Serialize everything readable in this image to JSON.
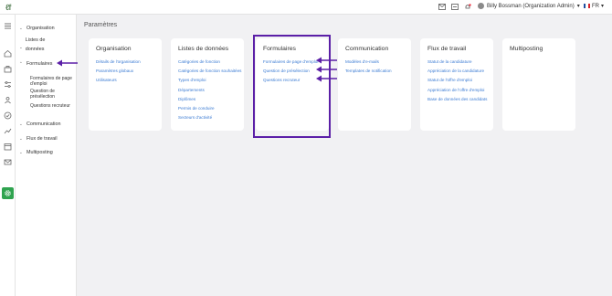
{
  "topbar": {
    "logo": "ℓf",
    "user_name": "Billy Bossman (Organization Admin)",
    "user_chevron": "▾",
    "language": "FR",
    "language_chevron": "▾"
  },
  "nav": {
    "items": [
      {
        "label": "Organisation",
        "chevron": "⌄"
      },
      {
        "label": "Listes de données",
        "chevron": "⌄"
      },
      {
        "label": "Formulaires",
        "chevron": "⌃"
      },
      {
        "label": "Communication",
        "chevron": "⌄"
      },
      {
        "label": "Flux de travail",
        "chevron": "⌄"
      },
      {
        "label": "Multiposting",
        "chevron": "⌄"
      }
    ],
    "formulaires_subitems": [
      "Formulaires de page d'emploi",
      "Question de présélection",
      "Questions recruteur"
    ]
  },
  "page_title": "Paramètres",
  "cards": [
    {
      "title": "Organisation",
      "links": [
        "Détails de l'organisation",
        "Paramètres globaux",
        "Utilisateurs"
      ]
    },
    {
      "title": "Listes de données",
      "links": [
        "Catégories de fonction",
        "Catégories de fonction souhaitées",
        "Types d'emploi",
        "Départements",
        "Diplômes",
        "Permis de conduire",
        "Secteurs d'activité"
      ]
    },
    {
      "title": "Formulaires",
      "links": [
        "Formulaires de page d'emploi",
        "Question de présélection",
        "Questions recruteur"
      ]
    },
    {
      "title": "Communication",
      "links": [
        "Modèles d'e-mails",
        "Templates de notification"
      ]
    },
    {
      "title": "Flux de travail",
      "links": [
        "Statut de la candidature",
        "Appréciation de la candidature",
        "Statut de l'offre d'emploi",
        "Appréciation de l'offre d'emploi",
        "Base de données des candidats"
      ]
    },
    {
      "title": "Multiposting",
      "links": []
    }
  ],
  "colors": {
    "accent_green": "#2fa34f",
    "link_blue": "#3b7bd3",
    "annotation_purple": "#5b1fa7"
  },
  "icons": [
    "menu-icon",
    "home-icon",
    "briefcase-icon",
    "filter-icon",
    "people-icon",
    "check-icon",
    "chart-icon",
    "calendar-icon",
    "mail-icon",
    "settings-icon",
    "notification-icon",
    "export-icon",
    "bell-icon"
  ]
}
